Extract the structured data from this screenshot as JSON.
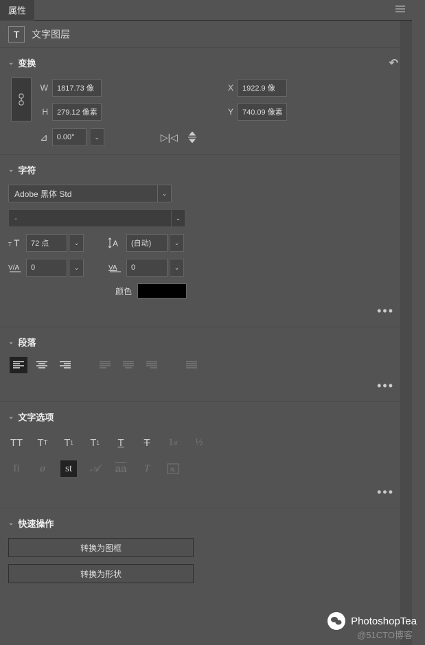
{
  "panel": {
    "title": "属性",
    "layer_type_badge": "T",
    "layer_type": "文字图层"
  },
  "transform": {
    "title": "变换",
    "w_label": "W",
    "w_value": "1817.73 像",
    "h_label": "H",
    "h_value": "279.12 像素",
    "x_label": "X",
    "x_value": "1922.9 像",
    "y_label": "Y",
    "y_value": "740.09 像素",
    "angle": "0.00°"
  },
  "character": {
    "title": "字符",
    "font": "Adobe 黑体 Std",
    "style": "-",
    "size": "72 点",
    "leading": "(自动)",
    "tracking": "0",
    "kerning": "0",
    "color_label": "颜色",
    "color": "#000000"
  },
  "paragraph": {
    "title": "段落"
  },
  "text_options": {
    "title": "文字选项"
  },
  "quick": {
    "title": "快速操作",
    "convert_frame": "转换为图框",
    "convert_shape": "转换为形状"
  },
  "watermark": {
    "main": "PhotoshopTea",
    "sub": "@51CTO博客"
  }
}
